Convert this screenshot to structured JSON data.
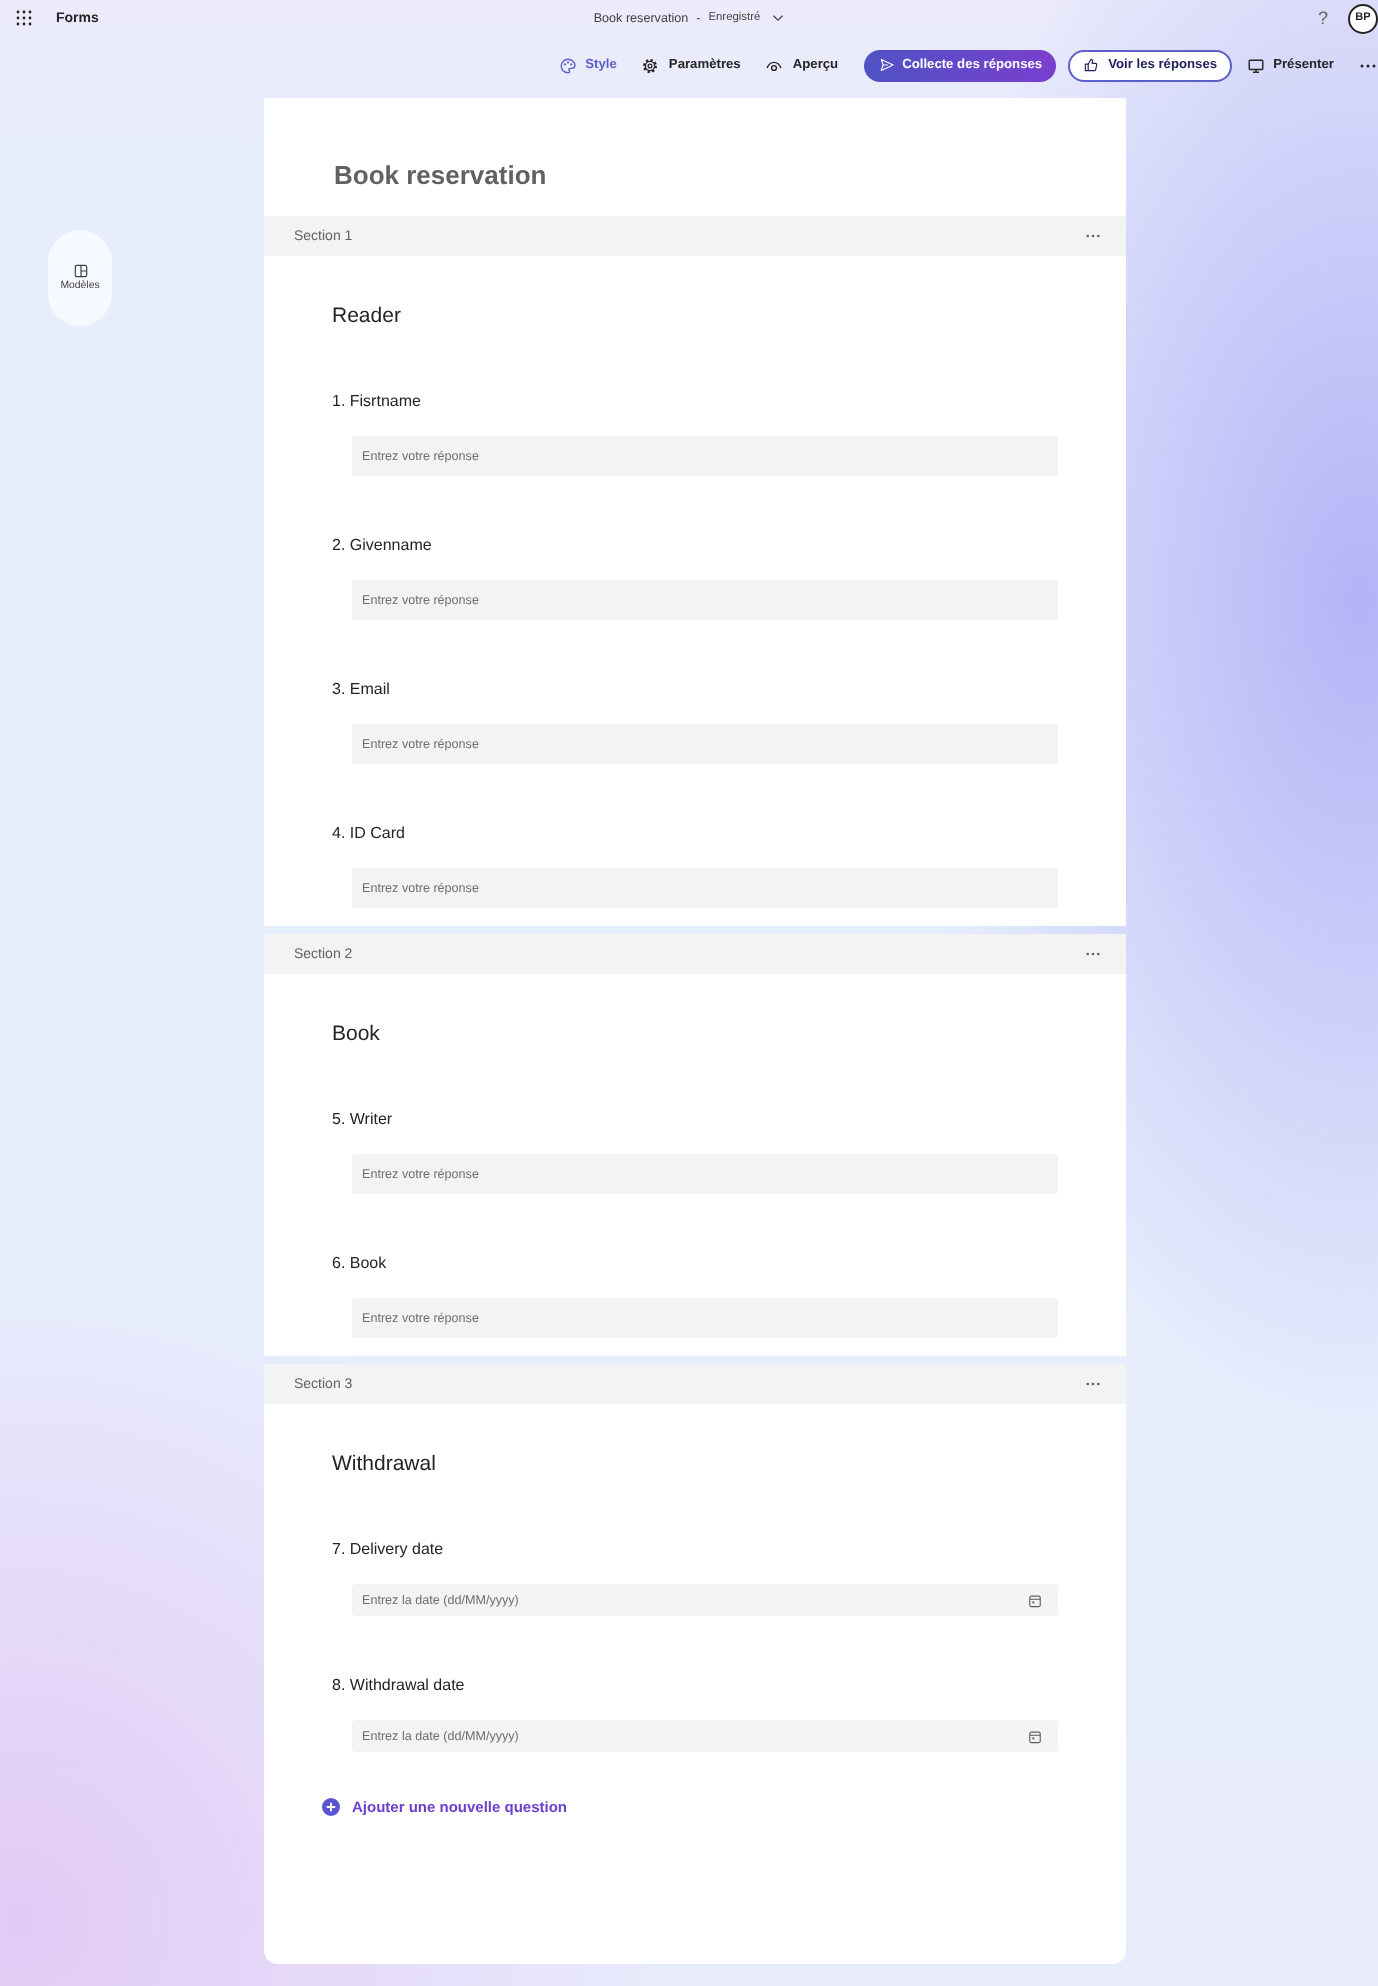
{
  "app_bar": {
    "app_name": "Forms",
    "document_title": "Book reservation",
    "title_separator": "-",
    "save_status": "Enregistré",
    "help": "?",
    "avatar_initials": "BP"
  },
  "toolbar": {
    "items": [
      {
        "kind": "tool",
        "label": "Style",
        "selected": true
      },
      {
        "kind": "tool",
        "label": "Paramètres",
        "selected": false
      },
      {
        "kind": "tool",
        "label": "Aperçu",
        "selected": false
      },
      {
        "kind": "primary",
        "label": "Collecte des réponses"
      },
      {
        "kind": "outline",
        "label": "Voir les réponses"
      },
      {
        "kind": "tool",
        "label": "Présenter",
        "selected": false
      },
      {
        "kind": "more"
      }
    ]
  },
  "sidebar": {
    "items": [
      {
        "label": "Modèles"
      }
    ]
  },
  "form": {
    "title": "Book reservation",
    "sections": [
      {
        "label": "Section 1",
        "heading": "Reader",
        "questions": [
          {
            "kind": "text",
            "label": "1. Fisrtname",
            "placeholder": "Entrez votre réponse"
          },
          {
            "kind": "text",
            "label": "2. Givenname",
            "placeholder": "Entrez votre réponse"
          },
          {
            "kind": "text",
            "label": "3. Email",
            "placeholder": "Entrez votre réponse"
          },
          {
            "kind": "text",
            "label": "4. ID Card",
            "placeholder": "Entrez votre réponse"
          }
        ]
      },
      {
        "label": "Section 2",
        "heading": "Book",
        "questions": [
          {
            "kind": "text",
            "label": "5. Writer",
            "placeholder": "Entrez votre réponse"
          },
          {
            "kind": "text",
            "label": "6. Book",
            "placeholder": "Entrez votre réponse"
          }
        ]
      },
      {
        "label": "Section 3",
        "heading": "Withdrawal",
        "questions": [
          {
            "kind": "date",
            "label": "7. Delivery date",
            "placeholder": "Entrez la date (dd/MM/yyyy)"
          },
          {
            "kind": "date",
            "label": "8. Withdrawal date",
            "placeholder": "Entrez la date (dd/MM/yyyy)"
          }
        ]
      }
    ],
    "add_question": "Ajouter une nouvelle question"
  }
}
